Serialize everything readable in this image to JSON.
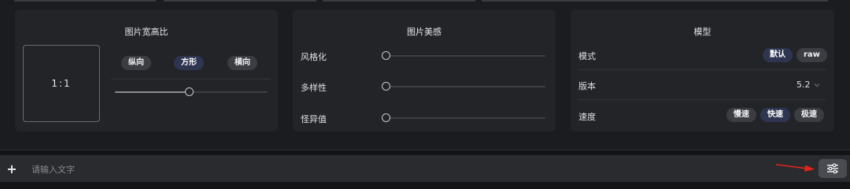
{
  "aspect_panel": {
    "title": "图片宽高比",
    "preview": "1:1",
    "orientations": [
      {
        "label": "纵向",
        "active": false
      },
      {
        "label": "方形",
        "active": true
      },
      {
        "label": "横向",
        "active": false
      }
    ],
    "slider_fraction": 0.49
  },
  "aesthetics_panel": {
    "title": "图片美感",
    "sliders": [
      {
        "label": "风格化",
        "fraction": 0.0
      },
      {
        "label": "多样性",
        "fraction": 0.0
      },
      {
        "label": "怪异值",
        "fraction": 0.0
      }
    ]
  },
  "model_panel": {
    "title": "模型",
    "mode_label": "模式",
    "mode_options": [
      {
        "label": "默认",
        "active": true
      },
      {
        "label": "raw",
        "active": false
      }
    ],
    "version_label": "版本",
    "version_value": "5.2",
    "speed_label": "速度",
    "speed_options": [
      {
        "label": "慢速",
        "active": false
      },
      {
        "label": "快速",
        "active": true
      },
      {
        "label": "极速",
        "active": false
      }
    ]
  },
  "prompt_bar": {
    "placeholder": "请输入文字",
    "add_icon": "plus-icon",
    "settings_icon": "sliders-icon"
  },
  "colors": {
    "accent_active": "#2e3550",
    "annotation_arrow": "#e0241c"
  }
}
